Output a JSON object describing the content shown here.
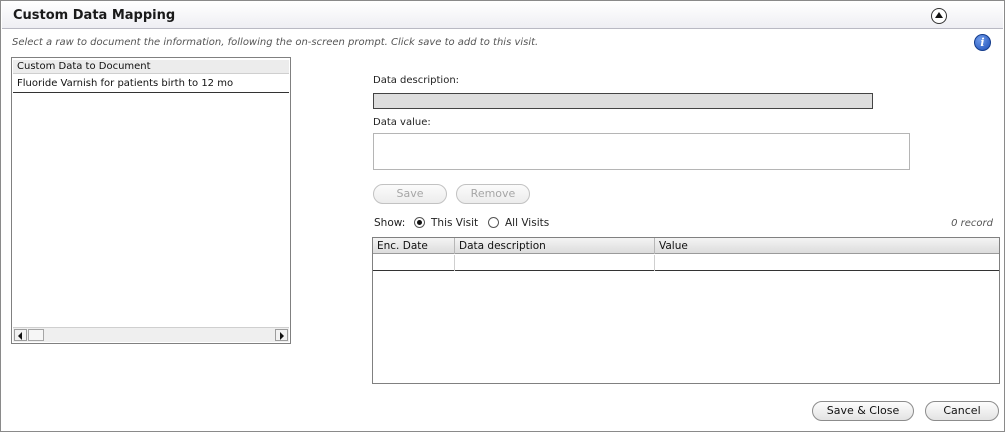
{
  "header": {
    "title": "Custom Data Mapping",
    "collapse_icon": "chevron-up-circle-icon"
  },
  "instruction": "Select a raw to document the information, following the on-screen prompt. Click save to add to this visit.",
  "info_icon": {
    "name": "info-icon",
    "glyph": "i",
    "color": "#1d4fb8"
  },
  "custom_data_list": {
    "header": "Custom Data to Document",
    "items": [
      "Fluoride Varnish for patients birth to 12 mo"
    ]
  },
  "form": {
    "description_label": "Data description:",
    "description_value": "",
    "value_label": "Data value:",
    "value_value": "",
    "save_label": "Save",
    "remove_label": "Remove"
  },
  "filter": {
    "show_label": "Show:",
    "options": [
      "This Visit",
      "All Visits"
    ],
    "selected": "This Visit",
    "record_count": "0 record"
  },
  "table": {
    "columns": [
      "Enc. Date",
      "Data description",
      "Value"
    ],
    "rows": []
  },
  "footer": {
    "save_close_label": "Save & Close",
    "cancel_label": "Cancel"
  }
}
